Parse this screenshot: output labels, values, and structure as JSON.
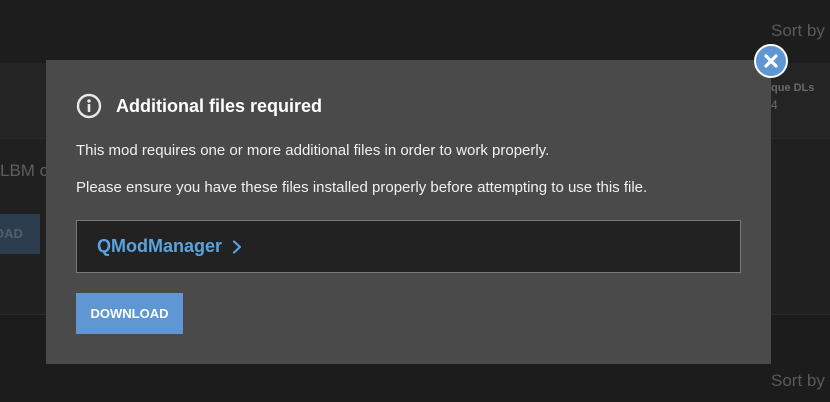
{
  "background": {
    "sort_label_top": "Sort by",
    "sort_label_bottom": "Sort by",
    "column_header": "que DLs",
    "column_value": "4",
    "row_text": "LBM c",
    "row_button_label": "OAD"
  },
  "modal": {
    "title": "Additional files required",
    "message_line_1": "This mod requires one or more additional files in order to work properly.",
    "message_line_2": "Please ensure you have these files installed properly before attempting to use this file.",
    "required_files": [
      {
        "name": "QModManager"
      }
    ],
    "download_label": "DOWNLOAD",
    "icons": {
      "title": "info-icon",
      "file_link": "chevron-right-icon",
      "close": "close-icon"
    },
    "colors": {
      "accent": "#5f97d4",
      "link": "#5aa3e0",
      "panel": "#4a4a4a"
    }
  }
}
